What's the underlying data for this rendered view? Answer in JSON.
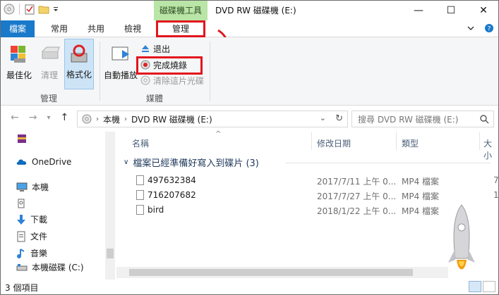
{
  "window": {
    "context_tab_group": "磁碟機工具",
    "title": "DVD RW 磁碟機 (E:)"
  },
  "tabs": [
    {
      "label": "檔案"
    },
    {
      "label": "常用"
    },
    {
      "label": "共用"
    },
    {
      "label": "檢視"
    },
    {
      "label": "管理"
    }
  ],
  "ribbon": {
    "optimize": "最佳化",
    "cleanup": "清理",
    "format": "格式化",
    "group_manage": "管理",
    "autoplay": "自動播放",
    "eject": "退出",
    "finish_burning": "完成燒錄",
    "erase_disc": "清除這片光碟",
    "group_media": "媒體"
  },
  "address": {
    "crumb_root": "本機",
    "crumb_current": "DVD RW 磁碟機 (E:)",
    "search_placeholder": "搜尋 DVD RW 磁碟機 (E:)"
  },
  "navpane": {
    "items": [
      {
        "label": ""
      },
      {
        "label": "OneDrive"
      },
      {
        "label": "本機"
      },
      {
        "label": ""
      },
      {
        "label": "下載"
      },
      {
        "label": "文件"
      },
      {
        "label": "音樂"
      },
      {
        "label": "本機磁碟 (C:)"
      }
    ]
  },
  "columns": {
    "name": "名稱",
    "date": "修改日期",
    "type": "類型",
    "size": "大小"
  },
  "group_header": "檔案已經準備好寫入到碟片 (3)",
  "files": [
    {
      "name": "497632384",
      "date": "2017/7/11 上午 0...",
      "type": "MP4 檔案",
      "size": "7"
    },
    {
      "name": "716207682",
      "date": "2017/7/27 上午 0...",
      "type": "MP4 檔案",
      "size": "1"
    },
    {
      "name": "bird",
      "date": "2018/1/22 上午 0...",
      "type": "MP4 檔案",
      "size": ""
    }
  ],
  "status": {
    "count": "3 個項目"
  },
  "colors": {
    "accent": "#1979ca",
    "context_green": "#b9e5a6",
    "highlight_red": "#e3151d"
  }
}
